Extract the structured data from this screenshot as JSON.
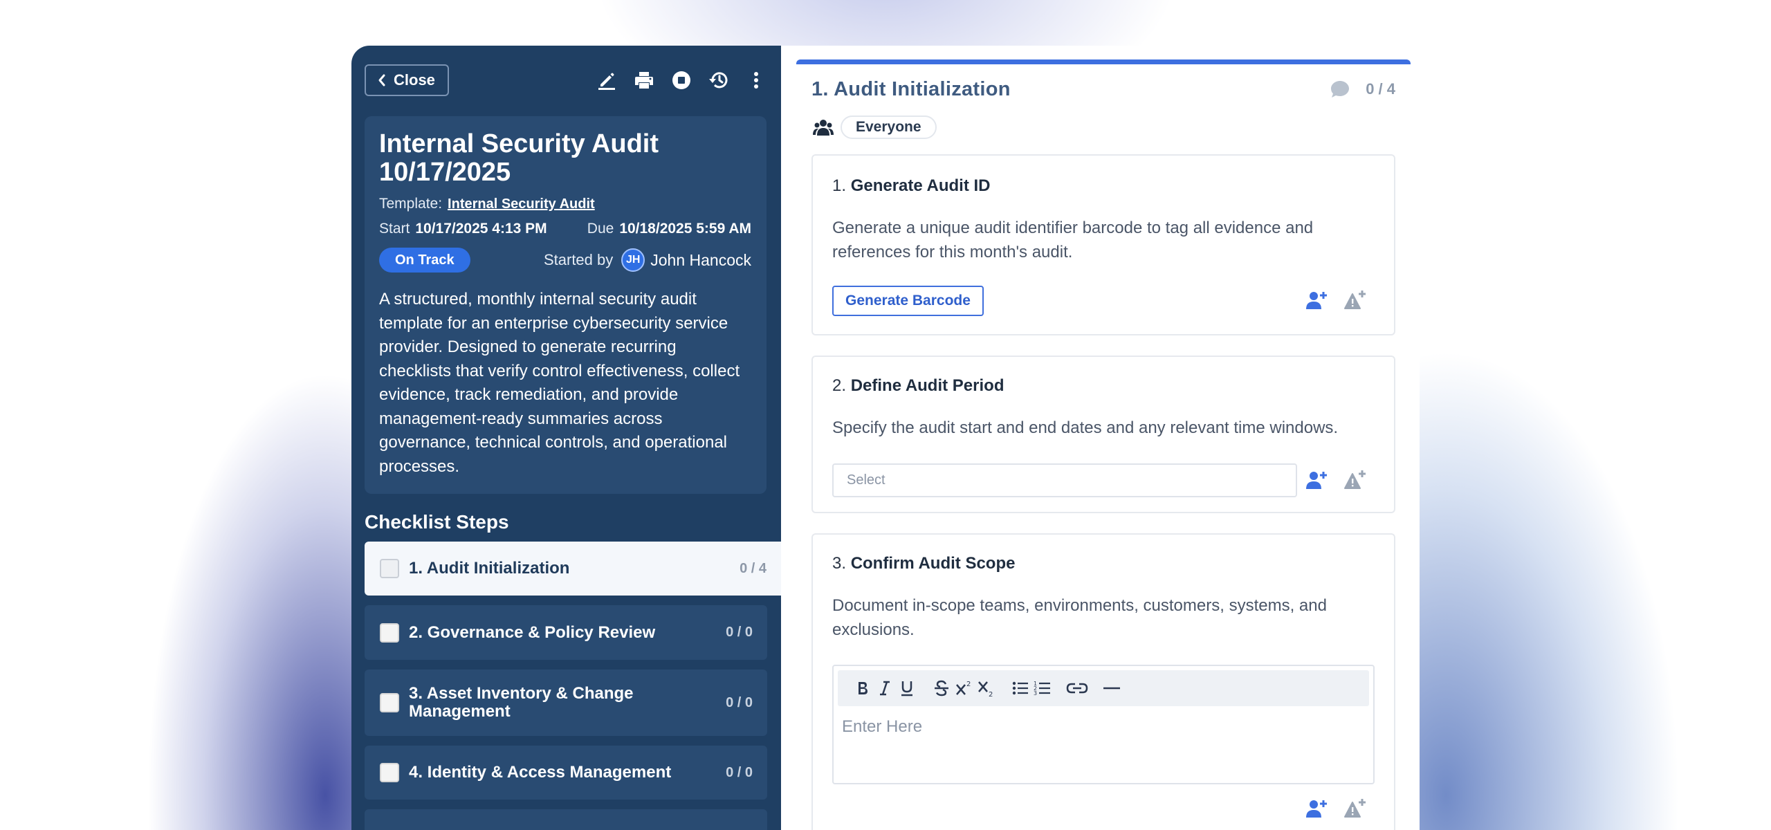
{
  "header": {
    "close_label": "Close",
    "toolbar_icons": [
      "edit-icon",
      "print-icon",
      "stop-icon",
      "history-icon",
      "more-icon"
    ]
  },
  "audit": {
    "title": "Internal Security Audit 10/17/2025",
    "template_label": "Template:",
    "template_name": "Internal Security Audit",
    "start_label": "Start",
    "start_value": "10/17/2025 4:13 PM",
    "due_label": "Due",
    "due_value": "10/18/2025 5:59 AM",
    "status": "On Track",
    "started_by_label": "Started by",
    "user_initials": "JH",
    "user_name": "John Hancock",
    "description": "A structured, monthly internal security audit template for an enterprise cybersecurity service provider. Designed to generate recurring checklists that verify control effectiveness, collect evidence, track remediation, and provide management-ready summaries across governance, technical controls, and operational processes."
  },
  "checklist": {
    "heading": "Checklist Steps",
    "steps": [
      {
        "label": "1. Audit Initialization",
        "count": "0 / 4"
      },
      {
        "label": "2. Governance & Policy Review",
        "count": "0 / 0"
      },
      {
        "label": "3. Asset Inventory & Change Management",
        "count": "0 / 0"
      },
      {
        "label": "4. Identity & Access Management",
        "count": "0 / 0"
      }
    ]
  },
  "section": {
    "title": "1. Audit Initialization",
    "count": "0 / 4",
    "assignee": "Everyone",
    "accent_color": "#3d6fe0",
    "items": [
      {
        "number": "1.",
        "title": "Generate Audit ID",
        "text": "Generate a unique audit identifier barcode to tag all evidence and references for this month's audit.",
        "button_label": "Generate Barcode"
      },
      {
        "number": "2.",
        "title": "Define Audit Period",
        "text": "Specify the audit start and end dates and any relevant time windows.",
        "select_placeholder": "Select"
      },
      {
        "number": "3.",
        "title": "Confirm Audit Scope",
        "text": "Document in-scope teams, environments, customers, systems, and exclusions.",
        "editor_placeholder": "Enter Here"
      }
    ]
  }
}
